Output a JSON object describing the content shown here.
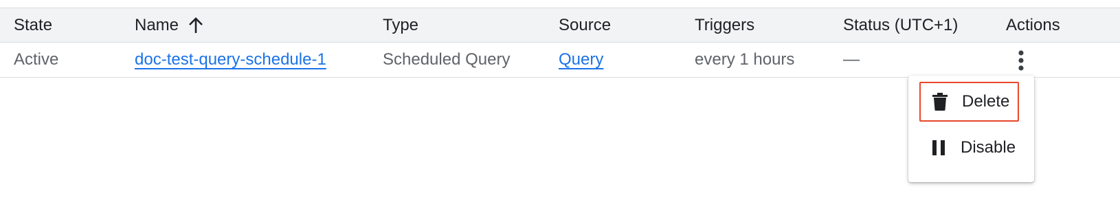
{
  "table": {
    "columns": [
      {
        "key": "state",
        "label": "State"
      },
      {
        "key": "name",
        "label": "Name",
        "sort": "ascending"
      },
      {
        "key": "type",
        "label": "Type"
      },
      {
        "key": "source",
        "label": "Source"
      },
      {
        "key": "triggers",
        "label": "Triggers"
      },
      {
        "key": "status",
        "label": "Status (UTC+1)"
      },
      {
        "key": "actions",
        "label": "Actions"
      }
    ],
    "rows": [
      {
        "state": "Active",
        "name": "doc-test-query-schedule-1",
        "type": "Scheduled Query",
        "source": "Query",
        "triggers": "every 1 hours",
        "status": "—"
      }
    ]
  },
  "actions_menu": {
    "items": [
      {
        "label": "Delete",
        "icon": "trash-icon",
        "highlighted": true
      },
      {
        "label": "Disable",
        "icon": "pause-icon"
      }
    ]
  },
  "colors": {
    "link": "#1a73e8",
    "header_bg": "#f1f3f4",
    "highlight_border": "#e8472a"
  }
}
